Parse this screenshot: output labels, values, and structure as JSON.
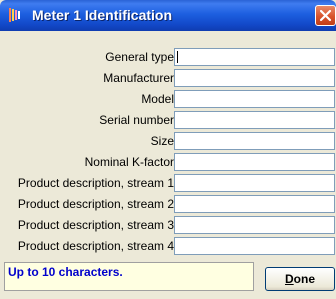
{
  "window": {
    "title": "Meter 1 Identification",
    "close_icon": "close-icon"
  },
  "fields": [
    {
      "label": "General type",
      "value": ""
    },
    {
      "label": "Manufacturer",
      "value": ""
    },
    {
      "label": "Model",
      "value": ""
    },
    {
      "label": "Serial number",
      "value": ""
    },
    {
      "label": "Size",
      "value": ""
    },
    {
      "label": "Nominal K-factor",
      "value": ""
    },
    {
      "label": "Product description, stream 1",
      "value": ""
    },
    {
      "label": "Product description, stream 2",
      "value": ""
    },
    {
      "label": "Product description, stream 3",
      "value": ""
    },
    {
      "label": "Product description, stream 4",
      "value": ""
    }
  ],
  "status": {
    "message": "Up to 10 characters."
  },
  "buttons": {
    "done_mnemonic": "D",
    "done_rest": "one"
  },
  "colors": {
    "titlebar": "#1d5fe0",
    "status_text": "#0000cc",
    "status_bg": "#ffffe1",
    "dialog_bg": "#ece9d8"
  }
}
